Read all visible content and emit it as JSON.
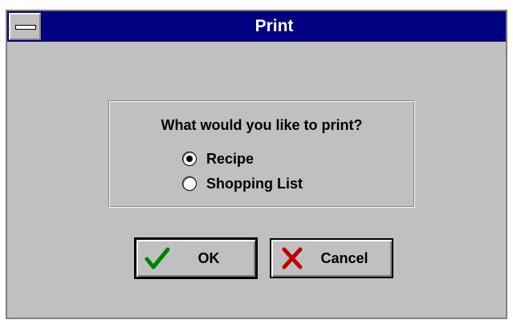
{
  "window": {
    "title": "Print"
  },
  "dialog": {
    "question": "What would you like to print?",
    "options": [
      {
        "label": "Recipe",
        "checked": true
      },
      {
        "label": "Shopping List",
        "checked": false
      }
    ]
  },
  "buttons": {
    "ok_label": "OK",
    "cancel_label": "Cancel"
  },
  "icons": {
    "system_menu": "system-menu-icon",
    "ok": "checkmark-icon",
    "cancel": "x-icon"
  },
  "colors": {
    "title_bar": "#000080",
    "dialog_face": "#c0c0c0",
    "ok_check": "#008000",
    "cancel_x": "#c00000"
  }
}
